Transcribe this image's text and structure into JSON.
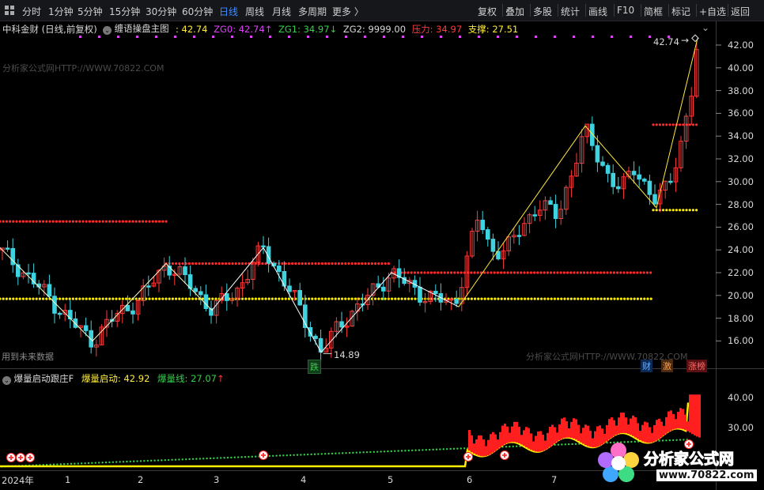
{
  "toolbar": {
    "tabs": [
      "分时",
      "1分钟",
      "5分钟",
      "15分钟",
      "30分钟",
      "60分钟",
      "日线",
      "周线",
      "月线",
      "多周期",
      "更多 〉"
    ],
    "active_tab": "日线",
    "right_buttons": [
      "复权",
      "叠加",
      "多股",
      "统计",
      "画线",
      "F10",
      "简框",
      "标记",
      "+自选",
      "返回"
    ]
  },
  "main_legend": {
    "stock": "中科金财 (日线,前复权)",
    "indicator": "缠语操盘主图",
    "value": ": 42.74",
    "zg0": "ZG0: 42.74",
    "zg1": "ZG1: 34.97",
    "zg2": "ZG2: 9999.00",
    "pressure": "压力: 34.97",
    "support": "支撑: 27.51"
  },
  "sub_legend": {
    "indicator": "爆量启动跟庄F",
    "start": "爆量启动: 42.92",
    "line": "爆量线: 27.07"
  },
  "price_axis": {
    "labels": [
      "42.00",
      "40.00",
      "38.00",
      "36.00",
      "34.00",
      "32.00",
      "30.00",
      "28.00",
      "26.00",
      "24.00",
      "22.00",
      "20.00",
      "18.00",
      "16.00"
    ],
    "values": [
      42,
      40,
      38,
      36,
      34,
      32,
      30,
      28,
      26,
      24,
      22,
      20,
      18,
      16
    ]
  },
  "sub_axis": {
    "labels": [
      "40.00",
      "30.00"
    ],
    "values": [
      40,
      30
    ]
  },
  "x_axis": {
    "labels": [
      "2024年",
      "1",
      "2",
      "3",
      "4",
      "5",
      "6",
      "7"
    ]
  },
  "annotations": {
    "high": "42.74",
    "low": "14.89",
    "fall_badge": "跌",
    "future_note": "用到未来数据",
    "badges": [
      "财",
      "激",
      "涨榜"
    ]
  },
  "watermarks": {
    "top": "分析家公式网HTTP://WWW.70822.COM",
    "bottom": "分析家公式网HTTP://WWW.70822.COM"
  },
  "logo": {
    "name": "分析家公式网",
    "url": "www.70822.com"
  },
  "colors": {
    "up": "#ff3b3b",
    "down": "#3fd3e0",
    "zigzag_main": "#ffffff",
    "zigzag_trend": "#ffeb3b",
    "pressure_dots": "#ff2a2a",
    "support_dots": "#ffee00",
    "zg0_color": "#e040fb",
    "zg1_color": "#35d04a",
    "accent_blue": "#3f8cff"
  }
}
